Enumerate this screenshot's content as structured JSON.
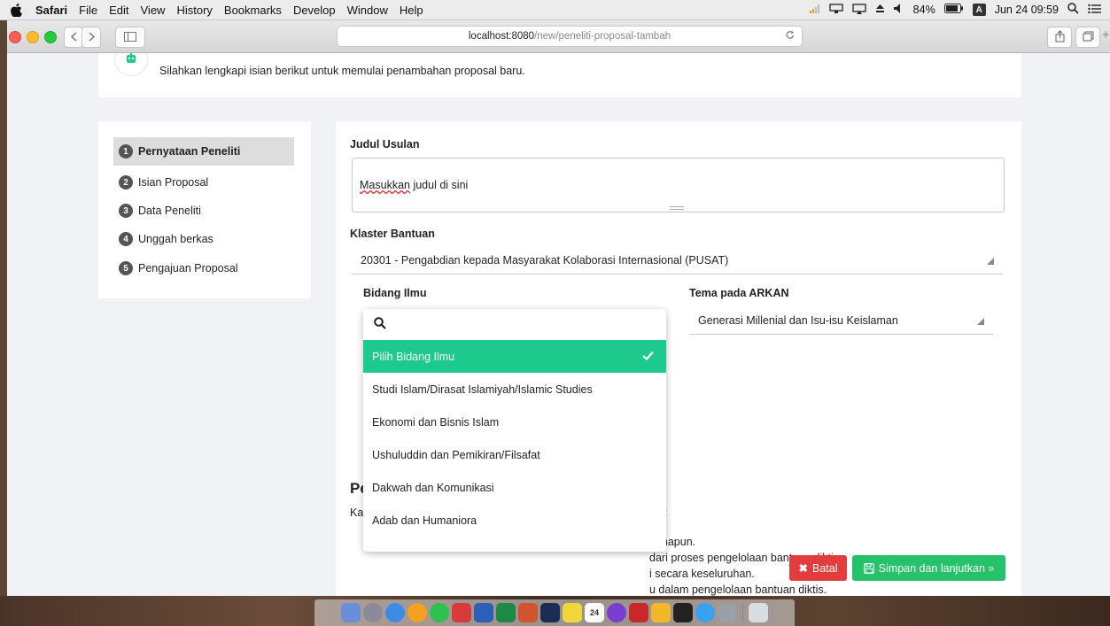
{
  "menubar": {
    "app": "Safari",
    "items": [
      "File",
      "Edit",
      "View",
      "History",
      "Bookmarks",
      "Develop",
      "Window",
      "Help"
    ],
    "battery": "84%",
    "input_source": "A",
    "clock": "Jun 24  09:59"
  },
  "browser": {
    "url_host": "localhost:8080",
    "url_path": "/new/peneliti-proposal-tambah"
  },
  "header": {
    "subtitle": "Silahkan lengkapi isian berikut untuk memulai penambahan proposal baru."
  },
  "steps": [
    {
      "num": "1",
      "label": "Pernyataan Peneliti",
      "active": true
    },
    {
      "num": "2",
      "label": "Isian Proposal"
    },
    {
      "num": "3",
      "label": "Data Peneliti"
    },
    {
      "num": "4",
      "label": "Unggah berkas"
    },
    {
      "num": "5",
      "label": "Pengajuan Proposal"
    }
  ],
  "form": {
    "judul_label": "Judul Usulan",
    "judul_value_a": "Masukkan",
    "judul_value_b": " judul di sini",
    "klaster_label": "Klaster Bantuan",
    "klaster_value": "20301 - Pengabdian kepada Masyarakat Kolaborasi Internasional (PUSAT)",
    "bidang_label": "Bidang Ilmu",
    "tema_label": "Tema pada ARKAN",
    "tema_value": "Generasi Millenial dan Isu-isu Keislaman"
  },
  "pernyataan": {
    "title": "Pe",
    "intro": "Ka",
    "colon": ":",
    "lines": [
      "nanapun.",
      "dari proses pengelolaan bantuan diktis.",
      "i secara keseluruhan.",
      "u dalam pengelolaan bantuan diktis."
    ]
  },
  "dropdown": {
    "search_value": "",
    "options": [
      "Pilih Bidang Ilmu",
      "Studi Islam/Dirasat Islamiyah/Islamic Studies",
      "Ekonomi dan Bisnis Islam",
      "Ushuluddin dan Pemikiran/Filsafat",
      "Dakwah dan Komunikasi",
      "Adab dan Humaniora"
    ],
    "selected_index": 0
  },
  "buttons": {
    "batal": "Batal",
    "simpan": "Simpan dan lanjutkan »"
  },
  "colors": {
    "accent_green": "#1dc98c",
    "danger": "#e23c3c",
    "success": "#26c26a"
  },
  "dock": {
    "calendar_day": "24"
  }
}
